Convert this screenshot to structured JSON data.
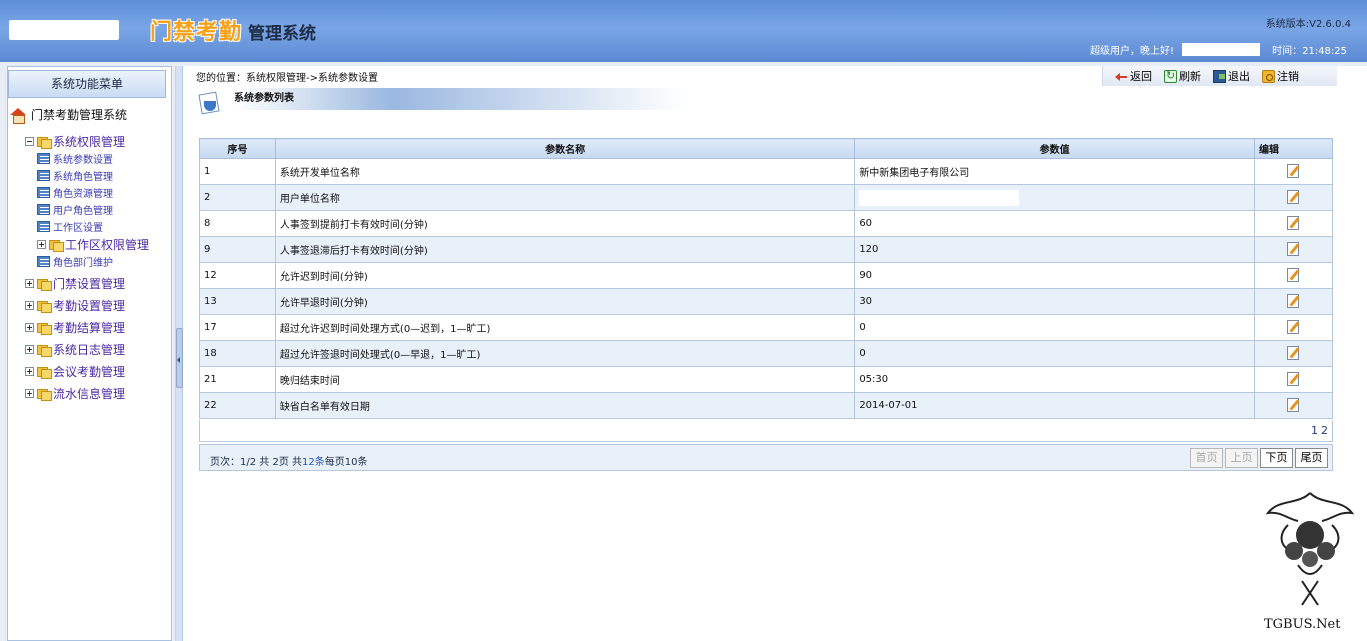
{
  "header": {
    "brand_orange": "门禁考勤",
    "brand_dark": "管理系统",
    "version": "系统版本:V2.6.0.4",
    "greeting": "超级用户，晚上好!",
    "time_label": "时间：21:48:25"
  },
  "sidebar": {
    "menu_title": "系统功能菜单",
    "root_label": "门禁考勤管理系统",
    "group_open": "系统权限管理",
    "sub_items": [
      "系统参数设置",
      "系统角色管理",
      "角色资源管理",
      "用户角色管理",
      "工作区设置"
    ],
    "sub_group": "工作区权限管理",
    "sub_last": "角色部门维护",
    "groups": [
      "门禁设置管理",
      "考勤设置管理",
      "考勤结算管理",
      "系统日志管理",
      "会议考勤管理",
      "流水信息管理"
    ]
  },
  "breadcrumb": "您的位置：系统权限管理->系统参数设置",
  "toolbar": {
    "back": "返回",
    "refresh": "刷新",
    "exit": "退出",
    "logout": "注销"
  },
  "section_title": "系统参数列表",
  "table": {
    "headers": [
      "序号",
      "参数名称",
      "参数值",
      "编辑"
    ],
    "rows": [
      {
        "id": "1",
        "name": "系统开发单位名称",
        "value": "新中新集团电子有限公司"
      },
      {
        "id": "2",
        "name": "用户单位名称",
        "value": ""
      },
      {
        "id": "8",
        "name": "人事签到提前打卡有效时间(分钟)",
        "value": "60"
      },
      {
        "id": "9",
        "name": "人事签退滞后打卡有效时间(分钟)",
        "value": "120"
      },
      {
        "id": "12",
        "name": "允许迟到时间(分钟)",
        "value": "90"
      },
      {
        "id": "13",
        "name": "允许早退时间(分钟)",
        "value": "30"
      },
      {
        "id": "17",
        "name": "超过允许迟到时间处理方式(0—迟到，1—旷工)",
        "value": "0"
      },
      {
        "id": "18",
        "name": "超过允许签退时间处理式(0—早退，1—旷工)",
        "value": "0"
      },
      {
        "id": "21",
        "name": "晚归结束时间",
        "value": "05:30"
      },
      {
        "id": "22",
        "name": "缺省白名单有效日期",
        "value": "2014-07-01"
      }
    ]
  },
  "pager": {
    "page_links": [
      "1",
      "2"
    ],
    "info_prefix": "页次：1/2 共  2页  共",
    "info_count": "12条",
    "info_suffix": "每页10条",
    "first": "首页",
    "prev": "上页",
    "next": "下页",
    "last": "尾页"
  },
  "watermark_text": "TGBUS.Net"
}
